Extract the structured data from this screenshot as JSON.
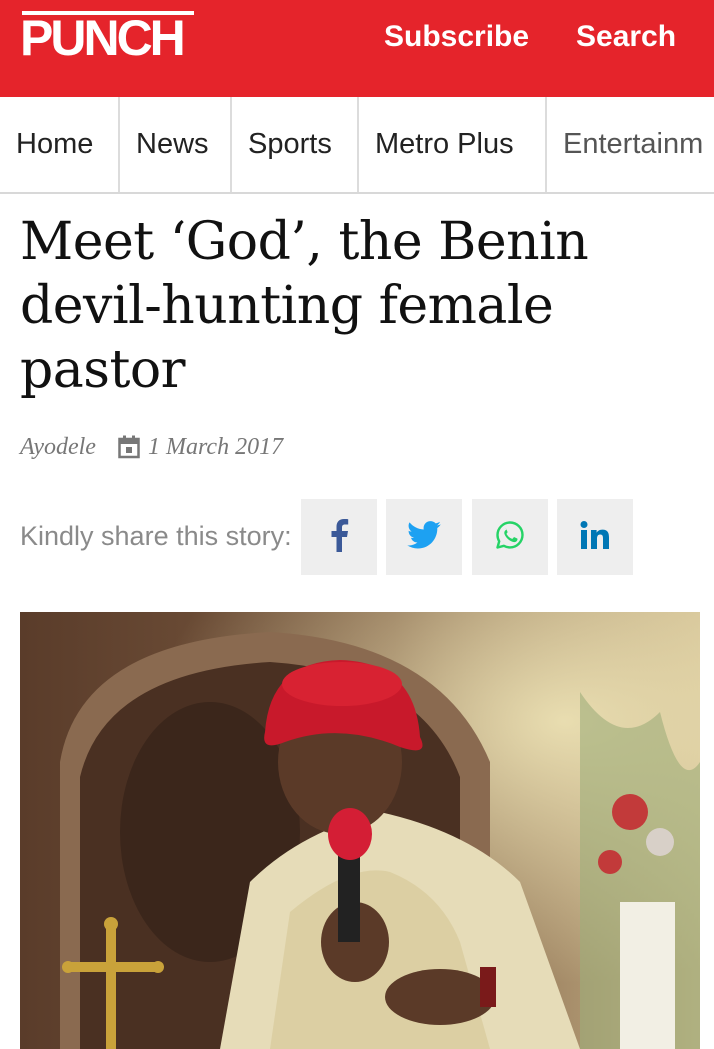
{
  "header": {
    "logo": "PUNCH",
    "subscribe_label": "Subscribe",
    "search_label": "Search",
    "brand_color": "#e5242b"
  },
  "nav": {
    "items": [
      {
        "label": "Home"
      },
      {
        "label": "News"
      },
      {
        "label": "Sports"
      },
      {
        "label": "Metro Plus"
      },
      {
        "label": "Entertainm"
      }
    ]
  },
  "article": {
    "title": "Meet ‘God’, the Benin devil-hunting female pastor",
    "author": "Ayodele",
    "date": "1 March 2017",
    "date_icon": "calendar-icon"
  },
  "share": {
    "label": "Kindly share this story:",
    "buttons": [
      {
        "name": "facebook",
        "icon": "facebook-icon",
        "color": "#3b5998"
      },
      {
        "name": "twitter",
        "icon": "twitter-icon",
        "color": "#1da1f2"
      },
      {
        "name": "whatsapp",
        "icon": "whatsapp-icon",
        "color": "#25d366"
      },
      {
        "name": "linkedin",
        "icon": "linkedin-icon",
        "color": "#0077b5"
      }
    ]
  }
}
